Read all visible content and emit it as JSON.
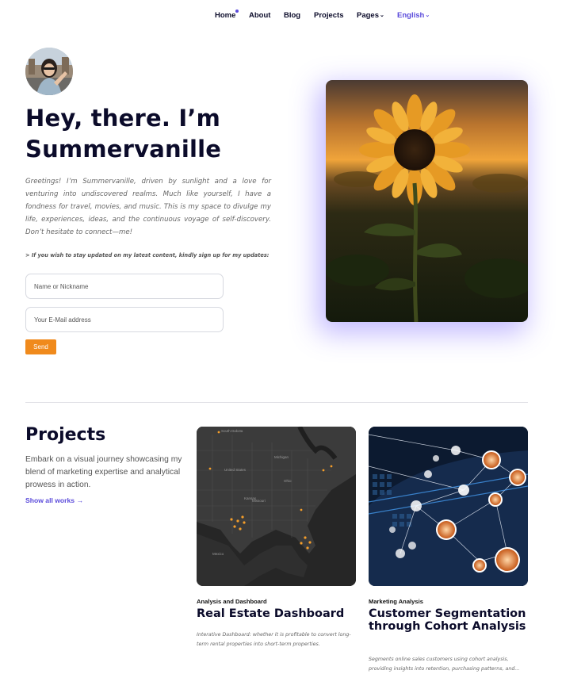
{
  "nav": {
    "items": [
      "Home",
      "About",
      "Blog",
      "Projects",
      "Pages",
      "English"
    ]
  },
  "hero": {
    "title": "Hey, there. I’m Summervanille",
    "intro": "Greetings! I’m Summervanille, driven by sunlight and a love for venturing into undiscovered realms. Much like yourself, I have a fondness for travel, movies, and music. This is my space to divulge my life, experiences, ideas, and the continuous voyage of self-discovery. Don’t hesitate to connect—me!",
    "signup_note": "> If you wish to stay updated on my latest content, kindly sign up for my updates:",
    "name_placeholder": "Name or Nickname",
    "email_placeholder": "Your E-Mail address",
    "send_label": "Send"
  },
  "projects": {
    "title": "Projects",
    "description": "Embark on a visual journey showcasing my blend of marketing expertise and analytical prowess in action.",
    "show_all": "Show all works →",
    "cards": [
      {
        "category": "Analysis and Dashboard",
        "title": "Real Estate Dashboard",
        "description": "Interative Dashboard: whether it is profitable to convert long-term rental properties into short-term properties."
      },
      {
        "category": "Marketing Analysis",
        "title": "Customer Segmentation through Cohort Analysis",
        "description": "Segments online sales customers using cohort analysis, providing insights into retention, purchasing patterns, and..."
      }
    ]
  },
  "colors": {
    "accent": "#5b4bdb",
    "button": "#f08a1c",
    "heading": "#0b0b2a"
  },
  "icons": {
    "pages_caret": "chevron-down-icon",
    "language_caret": "chevron-down-icon",
    "show_all_arrow": "arrow-right-icon"
  }
}
